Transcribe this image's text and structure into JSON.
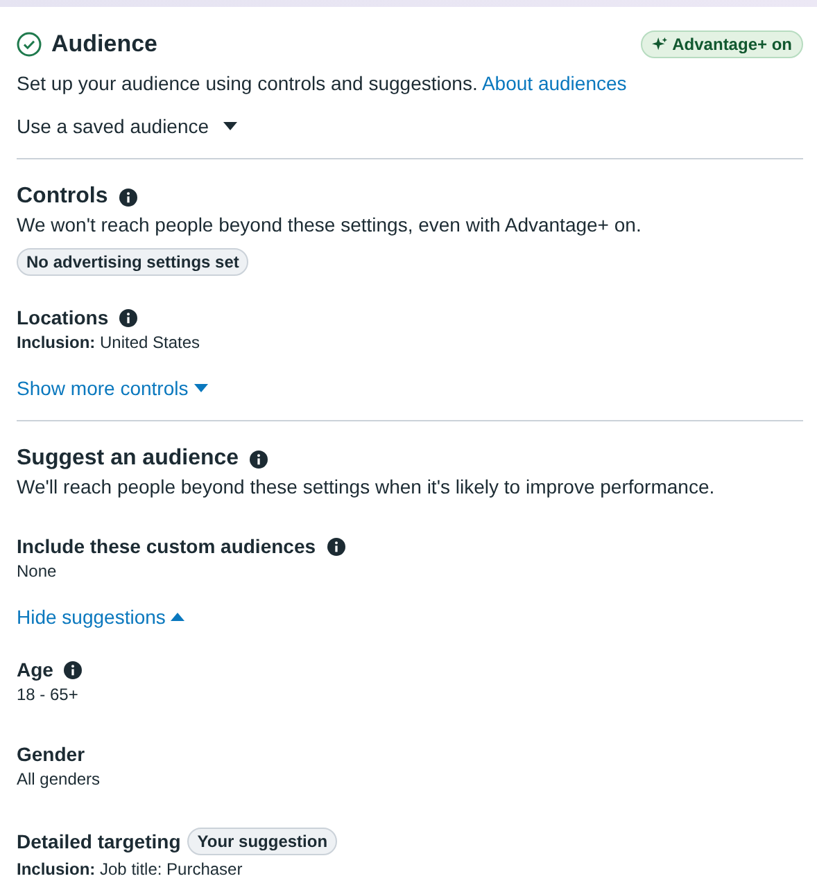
{
  "header": {
    "title": "Audience",
    "complete": true,
    "badge": "Advantage+ on"
  },
  "intro": {
    "text": "Set up your audience using controls and suggestions.",
    "link": "About audiences"
  },
  "saved_audience": {
    "label": "Use a saved audience",
    "expanded": false
  },
  "sections": [
    {
      "title": "Controls",
      "info": true,
      "description": "We won't reach people beyond these settings, even with Advantage+ on.",
      "items": [
        {
          "kind": "chip",
          "text": "No advertising settings set"
        },
        {
          "kind": "field",
          "label": "Locations",
          "info": true,
          "value": "**Inclusion:** United States"
        },
        {
          "kind": "toggle",
          "label": "Show more controls",
          "expanded": false
        }
      ]
    },
    {
      "title": "Suggest an audience",
      "info": true,
      "description": "We'll reach people beyond these settings when it's likely to improve performance.",
      "items": [
        {
          "kind": "field",
          "label": "Include these custom audiences",
          "info": true,
          "value": "None"
        },
        {
          "kind": "toggle",
          "label": "Hide suggestions",
          "expanded": true
        },
        {
          "kind": "field",
          "label": "Age",
          "info": true,
          "value": "18 - 65+"
        },
        {
          "kind": "field",
          "label": "Gender",
          "info": false,
          "value": "All genders"
        },
        {
          "kind": "field",
          "label": "Detailed targeting",
          "info": false,
          "badge": "Your suggestion",
          "value": "**Inclusion:** Job title: Purchaser"
        }
      ]
    }
  ]
}
